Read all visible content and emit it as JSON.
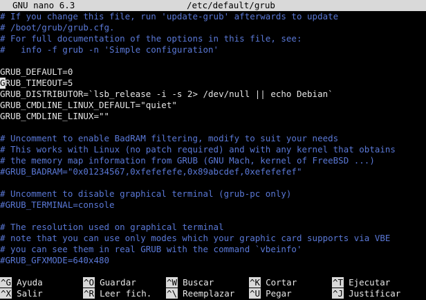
{
  "titlebar": {
    "app": "GNU nano 6.3",
    "file": "/etc/default/grub"
  },
  "editor": {
    "lines": [
      {
        "text": "# If you change this file, run 'update-grub' afterwards to update",
        "type": "comment"
      },
      {
        "text": "# /boot/grub/grub.cfg.",
        "type": "comment"
      },
      {
        "text": "# For full documentation of the options in this file, see:",
        "type": "comment"
      },
      {
        "text": "#   info -f grub -n 'Simple configuration'",
        "type": "comment"
      },
      {
        "text": "",
        "type": "plain"
      },
      {
        "text": "GRUB_DEFAULT=0",
        "type": "plain"
      },
      {
        "text": "GRUB_TIMEOUT=5",
        "type": "cursorline"
      },
      {
        "text": "GRUB_DISTRIBUTOR=`lsb_release -i -s 2> /dev/null || echo Debian`",
        "type": "plain"
      },
      {
        "text": "GRUB_CMDLINE_LINUX_DEFAULT=\"quiet\"",
        "type": "plain"
      },
      {
        "text": "GRUB_CMDLINE_LINUX=\"\"",
        "type": "plain"
      },
      {
        "text": "",
        "type": "plain"
      },
      {
        "text": "# Uncomment to enable BadRAM filtering, modify to suit your needs",
        "type": "comment"
      },
      {
        "text": "# This works with Linux (no patch required) and with any kernel that obtains",
        "type": "comment"
      },
      {
        "text": "# the memory map information from GRUB (GNU Mach, kernel of FreeBSD ...)",
        "type": "comment"
      },
      {
        "text": "#GRUB_BADRAM=\"0x01234567,0xfefefefe,0x89abcdef,0xefefefef\"",
        "type": "comment"
      },
      {
        "text": "",
        "type": "plain"
      },
      {
        "text": "# Uncomment to disable graphical terminal (grub-pc only)",
        "type": "comment"
      },
      {
        "text": "#GRUB_TERMINAL=console",
        "type": "comment"
      },
      {
        "text": "",
        "type": "plain"
      },
      {
        "text": "# The resolution used on graphical terminal",
        "type": "comment"
      },
      {
        "text": "# note that you can use only modes which your graphic card supports via VBE",
        "type": "comment"
      },
      {
        "text": "# you can see them in real GRUB with the command `vbeinfo'",
        "type": "comment"
      },
      {
        "text": "#GRUB_GFXMODE=640x480",
        "type": "comment"
      }
    ],
    "cursor_line_rest": "RUB_TIMEOUT=5",
    "cursor_char": "G"
  },
  "shortcuts": {
    "row1": [
      {
        "key": "^G",
        "label": "Ayuda"
      },
      {
        "key": "^O",
        "label": "Guardar"
      },
      {
        "key": "^W",
        "label": "Buscar"
      },
      {
        "key": "^K",
        "label": "Cortar"
      },
      {
        "key": "^T",
        "label": "Ejecutar"
      }
    ],
    "row2": [
      {
        "key": "^X",
        "label": "Salir"
      },
      {
        "key": "^R",
        "label": "Leer fich."
      },
      {
        "key": "^\\",
        "label": "Reemplazar"
      },
      {
        "key": "^U",
        "label": "Pegar"
      },
      {
        "key": "^J",
        "label": "Justificar"
      }
    ]
  }
}
